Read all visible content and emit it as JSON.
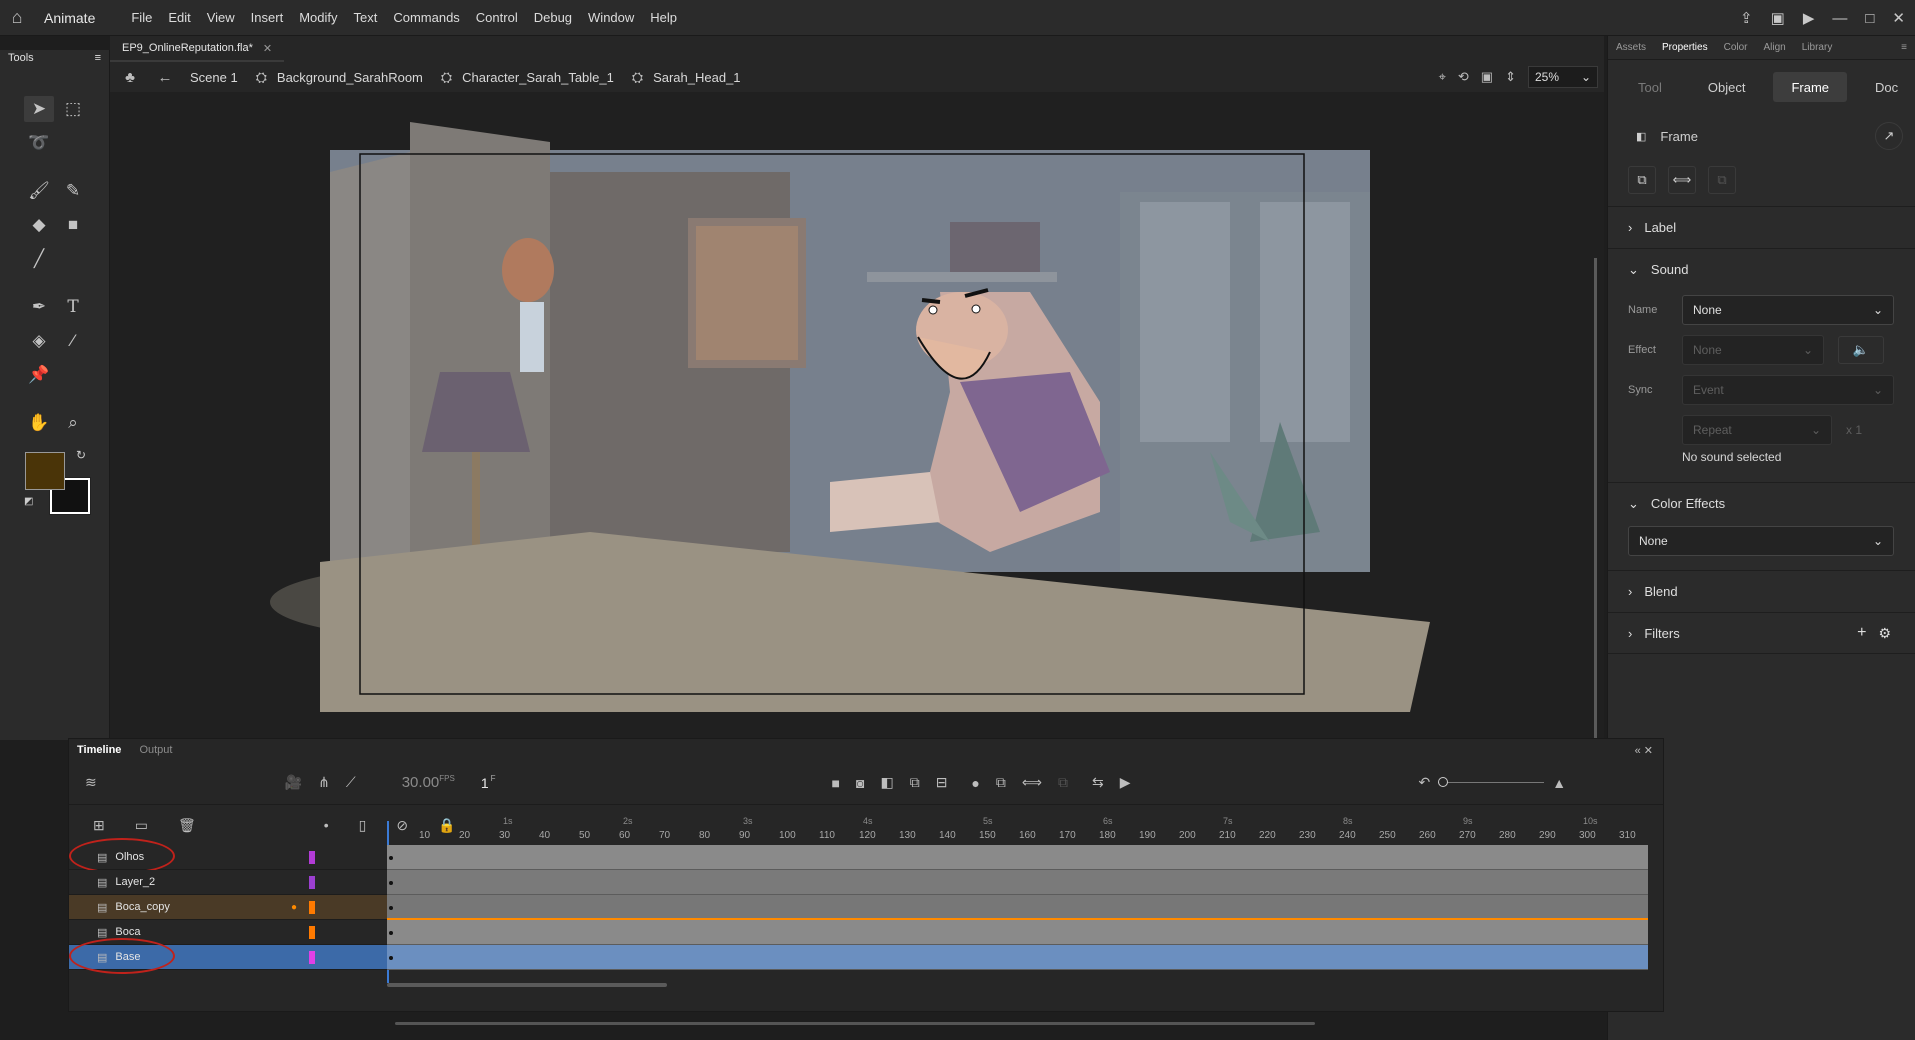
{
  "app": {
    "name": "Animate",
    "menus": [
      "File",
      "Edit",
      "View",
      "Insert",
      "Modify",
      "Text",
      "Commands",
      "Control",
      "Debug",
      "Window",
      "Help"
    ]
  },
  "tools_panel": {
    "title": "Tools"
  },
  "document": {
    "tab_title": "EP9_OnlineReputation.fla*"
  },
  "breadcrumb": {
    "items": [
      "Scene 1",
      "Background_SarahRoom",
      "Character_Sarah_Table_1",
      "Sarah_Head_1"
    ]
  },
  "stage": {
    "zoom": "25%"
  },
  "properties": {
    "panel_tabs": [
      "Assets",
      "Properties",
      "Color",
      "Align",
      "Library"
    ],
    "active_panel_tab": "Properties",
    "sub_tabs": [
      "Tool",
      "Object",
      "Frame",
      "Doc"
    ],
    "active_sub_tab": "Frame",
    "frame_title": "Frame",
    "label_section": "Label",
    "sound_section": "Sound",
    "sound": {
      "name_label": "Name",
      "name_value": "None",
      "effect_label": "Effect",
      "effect_value": "None",
      "sync_label": "Sync",
      "sync_value": "Event",
      "repeat_value": "Repeat",
      "repeat_count": "x 1",
      "status": "No sound selected"
    },
    "color_effects_section": "Color Effects",
    "color_effects_value": "None",
    "blend_section": "Blend",
    "filters_section": "Filters"
  },
  "timeline": {
    "tabs": [
      "Timeline",
      "Output"
    ],
    "fps": "30.00",
    "fps_unit": "FPS",
    "current_frame": "1",
    "frame_unit": "F",
    "ruler_labels": [
      "10",
      "20",
      "30",
      "40",
      "50",
      "60",
      "70",
      "80",
      "90",
      "100",
      "110",
      "120",
      "130",
      "140",
      "150",
      "160",
      "170",
      "180",
      "190",
      "200",
      "210",
      "220",
      "230",
      "240",
      "250",
      "260",
      "270",
      "280",
      "290",
      "300",
      "310"
    ],
    "second_labels": [
      "1s",
      "2s",
      "3s",
      "4s",
      "5s",
      "6s",
      "7s",
      "8s",
      "9s",
      "10s"
    ],
    "layers": [
      {
        "name": "Olhos",
        "color": "#b23bd6",
        "selected": false,
        "highlight": false
      },
      {
        "name": "Layer_2",
        "color": "#9c3fd0",
        "selected": false,
        "highlight": false
      },
      {
        "name": "Boca_copy",
        "color": "#ff7a00",
        "selected": false,
        "highlight": true
      },
      {
        "name": "Boca",
        "color": "#ff7a00",
        "selected": false,
        "highlight": false
      },
      {
        "name": "Base",
        "color": "#e040e6",
        "selected": true,
        "highlight": false
      }
    ],
    "annotated_layers": [
      "Olhos",
      "Base"
    ]
  },
  "colors": {
    "accent": "#3b7bd6",
    "selected_row": "#3c6aa8",
    "annotation": "#c0221b",
    "fill_swatch": "#4a3408"
  }
}
